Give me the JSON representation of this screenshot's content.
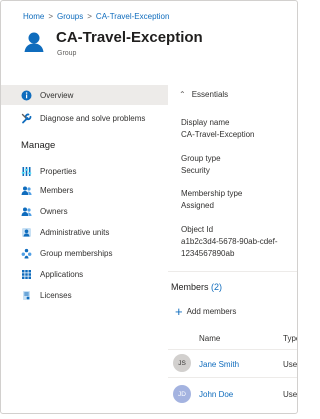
{
  "breadcrumb": {
    "items": [
      "Home",
      "Groups",
      "CA-Travel-Exception"
    ],
    "separator": ">"
  },
  "header": {
    "title": "CA-Travel-Exception",
    "subtitle": "Group",
    "icon": "group-icon"
  },
  "sidebar": {
    "top_items": [
      {
        "label": "Overview",
        "icon": "overview-icon",
        "selected": true
      },
      {
        "label": "Diagnose and solve problems",
        "icon": "wrench-icon",
        "selected": false
      }
    ],
    "manage_heading": "Manage",
    "manage_items": [
      {
        "label": "Properties",
        "icon": "properties-icon"
      },
      {
        "label": "Members",
        "icon": "members-icon"
      },
      {
        "label": "Owners",
        "icon": "owners-icon"
      },
      {
        "label": "Administrative units",
        "icon": "admin-units-icon"
      },
      {
        "label": "Group memberships",
        "icon": "group-memberships-icon"
      },
      {
        "label": "Applications",
        "icon": "applications-icon"
      },
      {
        "label": "Licenses",
        "icon": "licenses-icon"
      }
    ]
  },
  "essentials": {
    "toggle_label": "Essentials",
    "display_name_label": "Display name",
    "display_name_value": "CA-Travel-Exception",
    "group_type_label": "Group type",
    "group_type_value": "Security",
    "membership_type_label": "Membership type",
    "membership_type_value": "Assigned",
    "object_id_label": "Object Id",
    "object_id_line1": "a1b2c3d4-5678-90ab-cdef-",
    "object_id_line2": "1234567890ab"
  },
  "members": {
    "heading": "Members",
    "count": "(2)",
    "add_label": "Add members",
    "columns": {
      "name": "Name",
      "type": "Type"
    },
    "rows": [
      {
        "initials": "JS",
        "name": "Jane Smith",
        "type": "User",
        "avatar_bg": "#d2d0ce",
        "avatar_fg": "#323130"
      },
      {
        "initials": "JD",
        "name": "John Doe",
        "type": "User",
        "avatar_bg": "#a4b3e0",
        "avatar_fg": "#ffffff"
      }
    ]
  },
  "colors": {
    "accent": "#0f6cbd",
    "selected_bg": "#edebe9"
  }
}
